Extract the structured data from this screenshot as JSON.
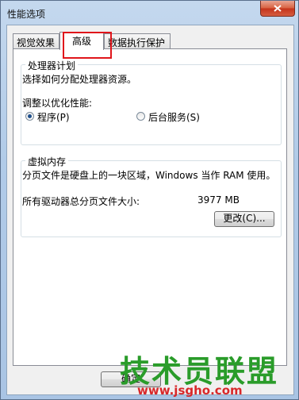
{
  "window": {
    "title": "性能选项"
  },
  "tabs": [
    {
      "label": "视觉效果"
    },
    {
      "label": "高级"
    },
    {
      "label": "数据执行保护"
    }
  ],
  "processor": {
    "group_title": "处理器计划",
    "description": "选择如何分配处理器资源。",
    "adjust_label": "调整以优化性能:",
    "options": [
      {
        "label": "程序(P)",
        "checked": true
      },
      {
        "label": "后台服务(S)",
        "checked": false
      }
    ]
  },
  "virtual_memory": {
    "group_title": "虚拟内存",
    "description": "分页文件是硬盘上的一块区域，Windows 当作 RAM 使用。",
    "total_label": "所有驱动器总分页文件大小:",
    "total_value": "3977 MB",
    "change_button": "更改(C)..."
  },
  "footer": {
    "ok_button": "确定"
  },
  "watermark": {
    "main": "技术员联盟",
    "url": "www.jsgho.com"
  }
}
